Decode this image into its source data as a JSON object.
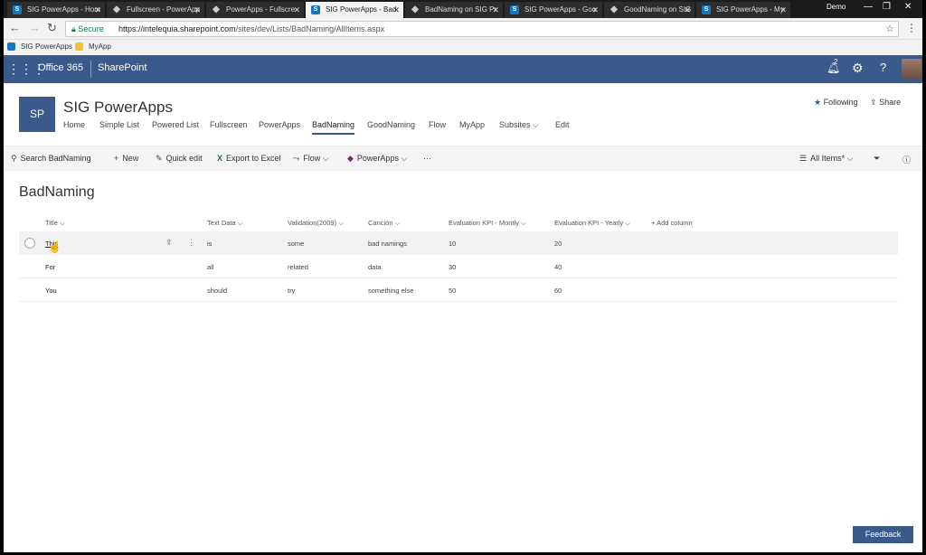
{
  "browser": {
    "tabs": [
      {
        "label": "SIG PowerApps - Hom",
        "icon": "sharepoint-icon",
        "active": false
      },
      {
        "label": "Fullscreen - PowerApp",
        "icon": "powerapps-icon",
        "active": false
      },
      {
        "label": "PowerApps - Fullscre",
        "icon": "powerapps-icon",
        "active": false
      },
      {
        "label": "SIG PowerApps - Bad",
        "icon": "sharepoint-icon",
        "active": true
      },
      {
        "label": "BadNaming on SIG Pr",
        "icon": "powerapps-icon",
        "active": false
      },
      {
        "label": "SIG PowerApps - Goo",
        "icon": "sharepoint-icon",
        "active": false
      },
      {
        "label": "GoodNaming on SIG",
        "icon": "powerapps-icon",
        "active": false
      },
      {
        "label": "SIG PowerApps - My",
        "icon": "sharepoint-icon",
        "active": false
      }
    ],
    "user": "Demo",
    "secure_label": "Secure",
    "url_host": "https://intelequia.sharepoint.com",
    "url_path": "/sites/dev/Lists/BadNaming/AllItems.aspx",
    "bookmarks": [
      "SIG PowerApps",
      "MyApp"
    ]
  },
  "suite": {
    "app_launcher_label": "Office 365",
    "product": "SharePoint",
    "notification_count": "2"
  },
  "site": {
    "logo": "SP",
    "title": "SIG PowerApps",
    "nav": [
      "Home",
      "Simple List",
      "Powered List",
      "Fullscreen",
      "PowerApps",
      "BadNaming",
      "GoodNaming",
      "Flow",
      "MyApp",
      "Subsites",
      "Edit"
    ],
    "selected_nav": "BadNaming",
    "following_label": "Following",
    "share_label": "Share"
  },
  "commands": {
    "search_placeholder": "Search BadNaming",
    "new": "New",
    "quick_edit": "Quick edit",
    "export": "Export to Excel",
    "flow": "Flow",
    "powerapps": "PowerApps",
    "more": "···",
    "view": "All Items*"
  },
  "list": {
    "title": "BadNaming",
    "columns": [
      "Title",
      "Text Data",
      "Validation(2009)",
      "Canción",
      "Evaluation KPI - Montly",
      "Evaluation KPI - Yearly"
    ],
    "add_column": "Add column",
    "rows": [
      [
        "This",
        "is",
        "some",
        "bad namings",
        "10",
        "20"
      ],
      [
        "For",
        "all",
        "related",
        "data",
        "30",
        "40"
      ],
      [
        "You",
        "should",
        "try",
        "something else",
        "50",
        "60"
      ]
    ]
  },
  "feedback_label": "Feedback",
  "colors": {
    "suite_bar": "#3b5a8c",
    "command_bar": "#f4f4f4"
  }
}
